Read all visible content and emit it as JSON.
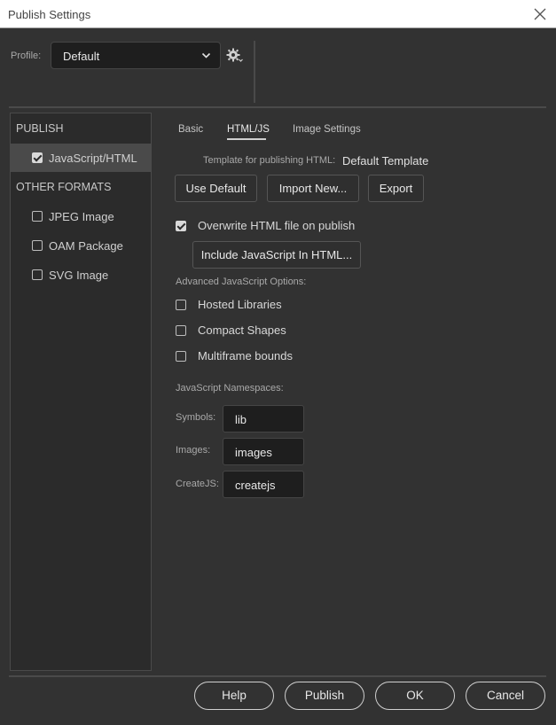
{
  "window": {
    "title": "Publish Settings"
  },
  "profile": {
    "label": "Profile:",
    "value": "Default"
  },
  "sidebar": {
    "publish_heading": "PUBLISH",
    "publish_items": [
      {
        "label": "JavaScript/HTML",
        "checked": true
      }
    ],
    "other_heading": "OTHER FORMATS",
    "other_items": [
      {
        "label": "JPEG Image",
        "checked": false
      },
      {
        "label": "OAM Package",
        "checked": false
      },
      {
        "label": "SVG Image",
        "checked": false
      }
    ]
  },
  "tabs": [
    {
      "label": "Basic"
    },
    {
      "label": "HTML/JS"
    },
    {
      "label": "Image Settings"
    }
  ],
  "active_tab": "HTML/JS",
  "template": {
    "label": "Template for publishing HTML:",
    "value": "Default Template",
    "buttons": {
      "use_default": "Use Default",
      "import_new": "Import New...",
      "export": "Export"
    }
  },
  "overwrite": {
    "label": "Overwrite HTML file on publish",
    "checked": true
  },
  "include_js_button": "Include JavaScript In HTML...",
  "advanced": {
    "label": "Advanced JavaScript Options:",
    "options": [
      {
        "label": "Hosted Libraries",
        "checked": false
      },
      {
        "label": "Compact Shapes",
        "checked": false
      },
      {
        "label": "Multiframe bounds",
        "checked": false
      }
    ]
  },
  "namespaces": {
    "label": "JavaScript Namespaces:",
    "symbols": {
      "label": "Symbols:",
      "value": "lib"
    },
    "images": {
      "label": "Images:",
      "value": "images"
    },
    "createjs": {
      "label": "CreateJS:",
      "value": "createjs"
    }
  },
  "footer": {
    "help": "Help",
    "publish": "Publish",
    "ok": "OK",
    "cancel": "Cancel"
  }
}
